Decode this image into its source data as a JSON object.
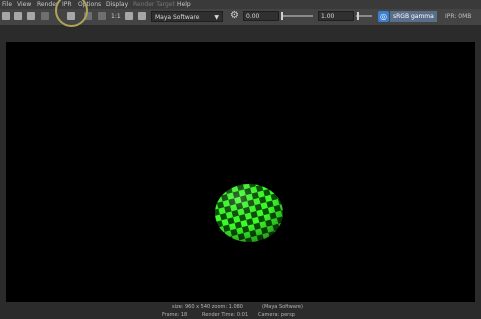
{
  "menu": [
    "File",
    "View",
    "Render",
    "IPR",
    "Options",
    "Display",
    "Render Target",
    "Help"
  ],
  "toolbar": {
    "zoom_ratio": "1:1",
    "renderer": "Maya Software",
    "exposure": "0.00",
    "gamma": "1.00",
    "color_space": "sRGB gamma",
    "ipr_memory": "IPR: 0MB"
  },
  "status": {
    "size": "size: 960 x 540 zoom: 1.080",
    "renderer": "(Maya Software)",
    "frame": "Frame: 18",
    "render_time": "Render Time: 0:01",
    "camera": "Camera: persp"
  },
  "colors": {
    "sphere_green": "#3cff2a",
    "sphere_dark": "#0b4f07",
    "highlight_circle": "#b0a457"
  }
}
